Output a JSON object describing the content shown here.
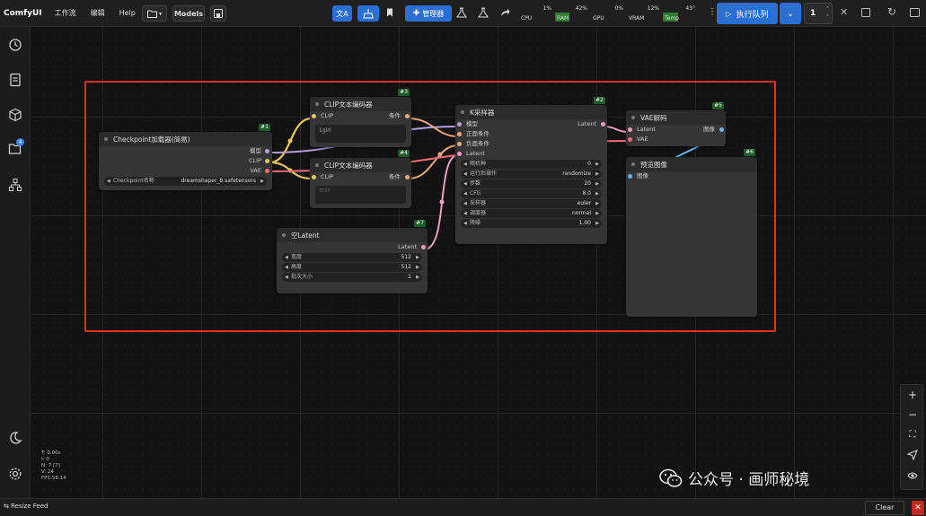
{
  "app": {
    "name": "ComfyUI"
  },
  "menu": {
    "workflow": "工作流",
    "edit": "编辑",
    "help": "Help"
  },
  "toolbar": {
    "models_label": "Models",
    "manager_label": "管理器",
    "queue_label": "执行队列",
    "queue_count": "1"
  },
  "meters": [
    {
      "label": "CPU",
      "percent": "1%",
      "level": 0.01
    },
    {
      "label": "RAM",
      "percent": "42%",
      "level": 0.42
    },
    {
      "label": "GPU",
      "percent": "0%",
      "level": 0.0
    },
    {
      "label": "VRAM",
      "percent": "12%",
      "level": 0.12
    },
    {
      "label": "Temp",
      "percent": "43°",
      "level": 0.43
    }
  ],
  "sidebar": {
    "badge_count": "4"
  },
  "nodes": {
    "checkpoint": {
      "id": "#1",
      "title": "Checkpoint加载器(简易)",
      "outputs": [
        "模型",
        "CLIP",
        "VAE"
      ],
      "widget_label": "Checkpoint名称",
      "widget_value": "dreamshaper_8.safetensors"
    },
    "clip_pos": {
      "id": "#3",
      "title": "CLIP文本编码器",
      "input": "CLIP",
      "output": "条件",
      "text": "1girl"
    },
    "clip_neg": {
      "id": "#4",
      "title": "CLIP文本编码器",
      "input": "CLIP",
      "output": "条件",
      "placeholder": "TEXT"
    },
    "ksampler": {
      "id": "#2",
      "title": "K采样器",
      "inputs": [
        "模型",
        "正面条件",
        "负面条件",
        "Latent"
      ],
      "output": "Latent",
      "widgets": [
        {
          "label": "随机种",
          "value": "0"
        },
        {
          "label": "运行后操作",
          "value": "randomize"
        },
        {
          "label": "步数",
          "value": "20"
        },
        {
          "label": "CFG",
          "value": "8.0"
        },
        {
          "label": "采样器",
          "value": "euler"
        },
        {
          "label": "调度器",
          "value": "normal"
        },
        {
          "label": "降噪",
          "value": "1.00"
        }
      ]
    },
    "empty_latent": {
      "id": "#7",
      "title": "空Latent",
      "output": "Latent",
      "widgets": [
        {
          "label": "宽度",
          "value": "512"
        },
        {
          "label": "高度",
          "value": "512"
        },
        {
          "label": "批次大小",
          "value": "1"
        }
      ]
    },
    "vae_decode": {
      "id": "#5",
      "title": "VAE解码",
      "inputs": [
        "Latent",
        "VAE"
      ],
      "output": "图像"
    },
    "preview": {
      "id": "#6",
      "title": "预览图像",
      "input": "图像"
    }
  },
  "stats": [
    "T: 0.00s",
    "I: 0",
    "N: 7 [7]",
    "V: 24",
    "FPS:58.14"
  ],
  "watermark": {
    "text": "公众号 · 画师秘境"
  },
  "bottom": {
    "resize_feed": "Resize Feed",
    "clear": "Clear"
  },
  "colors": {
    "accent": "#2a6fd1",
    "selection": "#e0331f",
    "clip": "#e8c65c",
    "model": "#b39ddb",
    "conditioning": "#f0a87a",
    "latent": "#e6a0c4",
    "vae": "#f06b7a",
    "image": "#64b5f6"
  }
}
